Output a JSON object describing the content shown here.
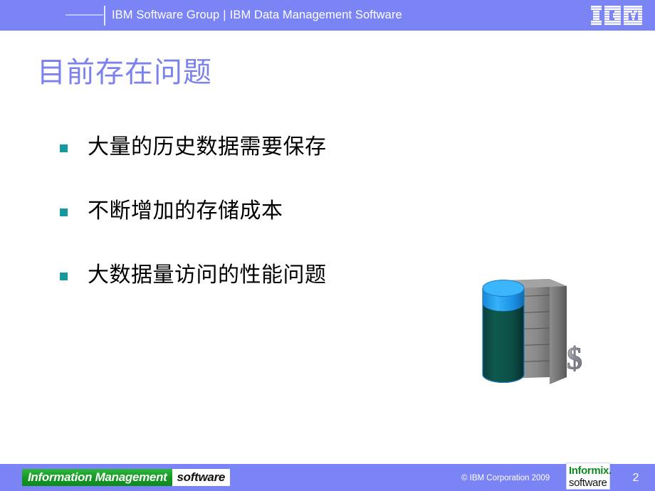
{
  "header": {
    "group_label": "IBM Software Group",
    "separator": "|",
    "product_label": "IBM Data Management Software",
    "logo_text": "IBM",
    "bar_color": "#7b84f5",
    "text_color": "#ffffff"
  },
  "title": {
    "text": "目前存在问题",
    "color": "#7b82ee"
  },
  "bullets": [
    {
      "text": "大量的历史数据需要保存",
      "marker": "square-bullet",
      "marker_color": "#16999e"
    },
    {
      "text": "不断增加的存储成本",
      "marker": "square-bullet",
      "marker_color": "#16999e"
    },
    {
      "text": "大数据量访问的性能问题",
      "marker": "square-bullet",
      "marker_color": "#16999e"
    }
  ],
  "graphic": {
    "name": "server-rack-storage-cost-illustration",
    "cylinder_top_color": "#1f9ef0",
    "cylinder_body_color": "#0d4f47",
    "rack_color": "#8e8e8e",
    "led_color": "#3fae2a",
    "dollar_color": "#9a9aa2",
    "dollar_symbol": "$",
    "rack_units": 6
  },
  "footer": {
    "im_logo_green_text": "Information Management",
    "im_logo_white_text": "software",
    "copyright": "© IBM Corporation 2009",
    "informix_top": "Informix.",
    "informix_bottom": "software",
    "page_number": "2",
    "bar_color": "#7b84f5"
  }
}
